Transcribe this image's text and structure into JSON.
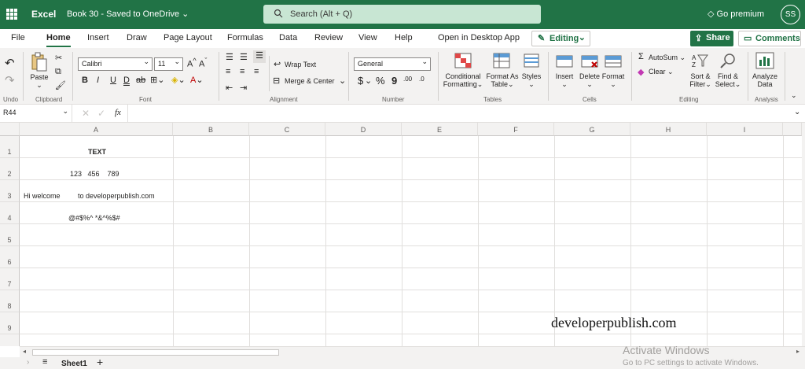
{
  "topbar": {
    "app_name": "Excel",
    "book_title": "Book 30 - Saved to OneDrive ⌄",
    "search_placeholder": "Search (Alt + Q)",
    "premium": "Go premium",
    "avatar": "SS",
    "color": "#217346"
  },
  "menu": {
    "tabs": [
      "File",
      "Home",
      "Insert",
      "Draw",
      "Page Layout",
      "Formulas",
      "Data",
      "Review",
      "View",
      "Help",
      "Open in Desktop App"
    ],
    "editing": "Editing",
    "share": "Share",
    "comments": "Comments"
  },
  "ribbon": {
    "paste": "Paste",
    "font_name": "Calibri",
    "font_size": "11",
    "wrap_text": "Wrap Text",
    "merge_center": "Merge & Center",
    "number_format": "General",
    "conditional_formatting": [
      "Conditional",
      "Formatting"
    ],
    "format_as_table": [
      "Format As",
      "Table"
    ],
    "styles": "Styles",
    "insert": "Insert",
    "delete": "Delete",
    "format": "Format",
    "autosum": "AutoSum",
    "clear": "Clear",
    "sort_filter": [
      "Sort &",
      "Filter"
    ],
    "find_select": [
      "Find &",
      "Select"
    ],
    "analyze_data": [
      "Analyze",
      "Data"
    ],
    "groups": {
      "undo": "Undo",
      "clipboard": "Clipboard",
      "font": "Font",
      "alignment": "Alignment",
      "number": "Number",
      "tables": "Tables",
      "cells": "Cells",
      "editing": "Editing",
      "analysis": "Analysis"
    },
    "font_buttons": [
      "B",
      "I",
      "U",
      "D"
    ],
    "number_buttons": [
      "$",
      "%",
      "9"
    ]
  },
  "formula_bar": {
    "name_box": "R44",
    "fx": "fx",
    "value": ""
  },
  "sheet": {
    "columns": [
      "A",
      "B",
      "C",
      "D",
      "E",
      "F",
      "G",
      "H",
      "I"
    ],
    "rows": [
      "1",
      "2",
      "3",
      "4",
      "5",
      "6",
      "7",
      "8",
      "9"
    ],
    "cells": {
      "A1": "TEXT",
      "A2": "123   456    789",
      "A3": "Hi welcome         to developerpublish.com",
      "A4": "@#$%^ *&^%$#"
    },
    "tab": "Sheet1",
    "watermark": "developerpublish.com"
  },
  "activation": {
    "title": "Activate Windows",
    "subtitle": "Go to PC settings to activate Windows."
  }
}
